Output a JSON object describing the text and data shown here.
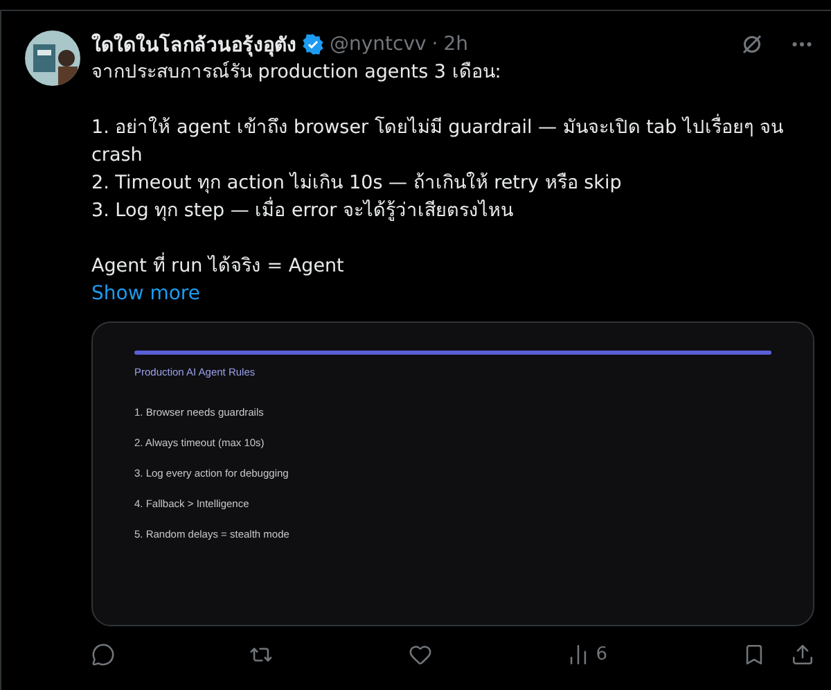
{
  "post": {
    "author_name": "ใดใดในโลกล้วนอรุ้งอุตัง",
    "verified": true,
    "handle": "@nyntcvv",
    "separator": "·",
    "time": "2h",
    "paragraphs": [
      [
        "จากประสบการณ์รัน production agents 3 เดือน:"
      ],
      [
        "1. อย่าให้ agent เข้าถึง browser โดยไม่มี guardrail — มันจะเปิด tab ไปเรื่อยๆ จน crash",
        "2. Timeout ทุก action ไม่เกิน 10s — ถ้าเกินให้ retry หรือ skip",
        "3. Log ทุก step — เมื่อ error จะได้รู้ว่าเสียตรงไหน"
      ],
      [
        "Agent ที่ run ได้จริง = Agent"
      ]
    ],
    "show_more": "Show more",
    "image": {
      "title": "Production AI Agent Rules",
      "items": [
        "1. Browser needs guardrails",
        "2. Always timeout (max 10s)",
        "3. Log every action for debugging",
        "4. Fallback > Intelligence",
        "5. Random delays = stealth mode"
      ]
    },
    "actions": [
      {
        "kind": "reply"
      },
      {
        "kind": "repost"
      },
      {
        "kind": "like"
      },
      {
        "kind": "views",
        "count": "6"
      },
      {
        "kind": "bookmark"
      },
      {
        "kind": "share"
      }
    ]
  }
}
